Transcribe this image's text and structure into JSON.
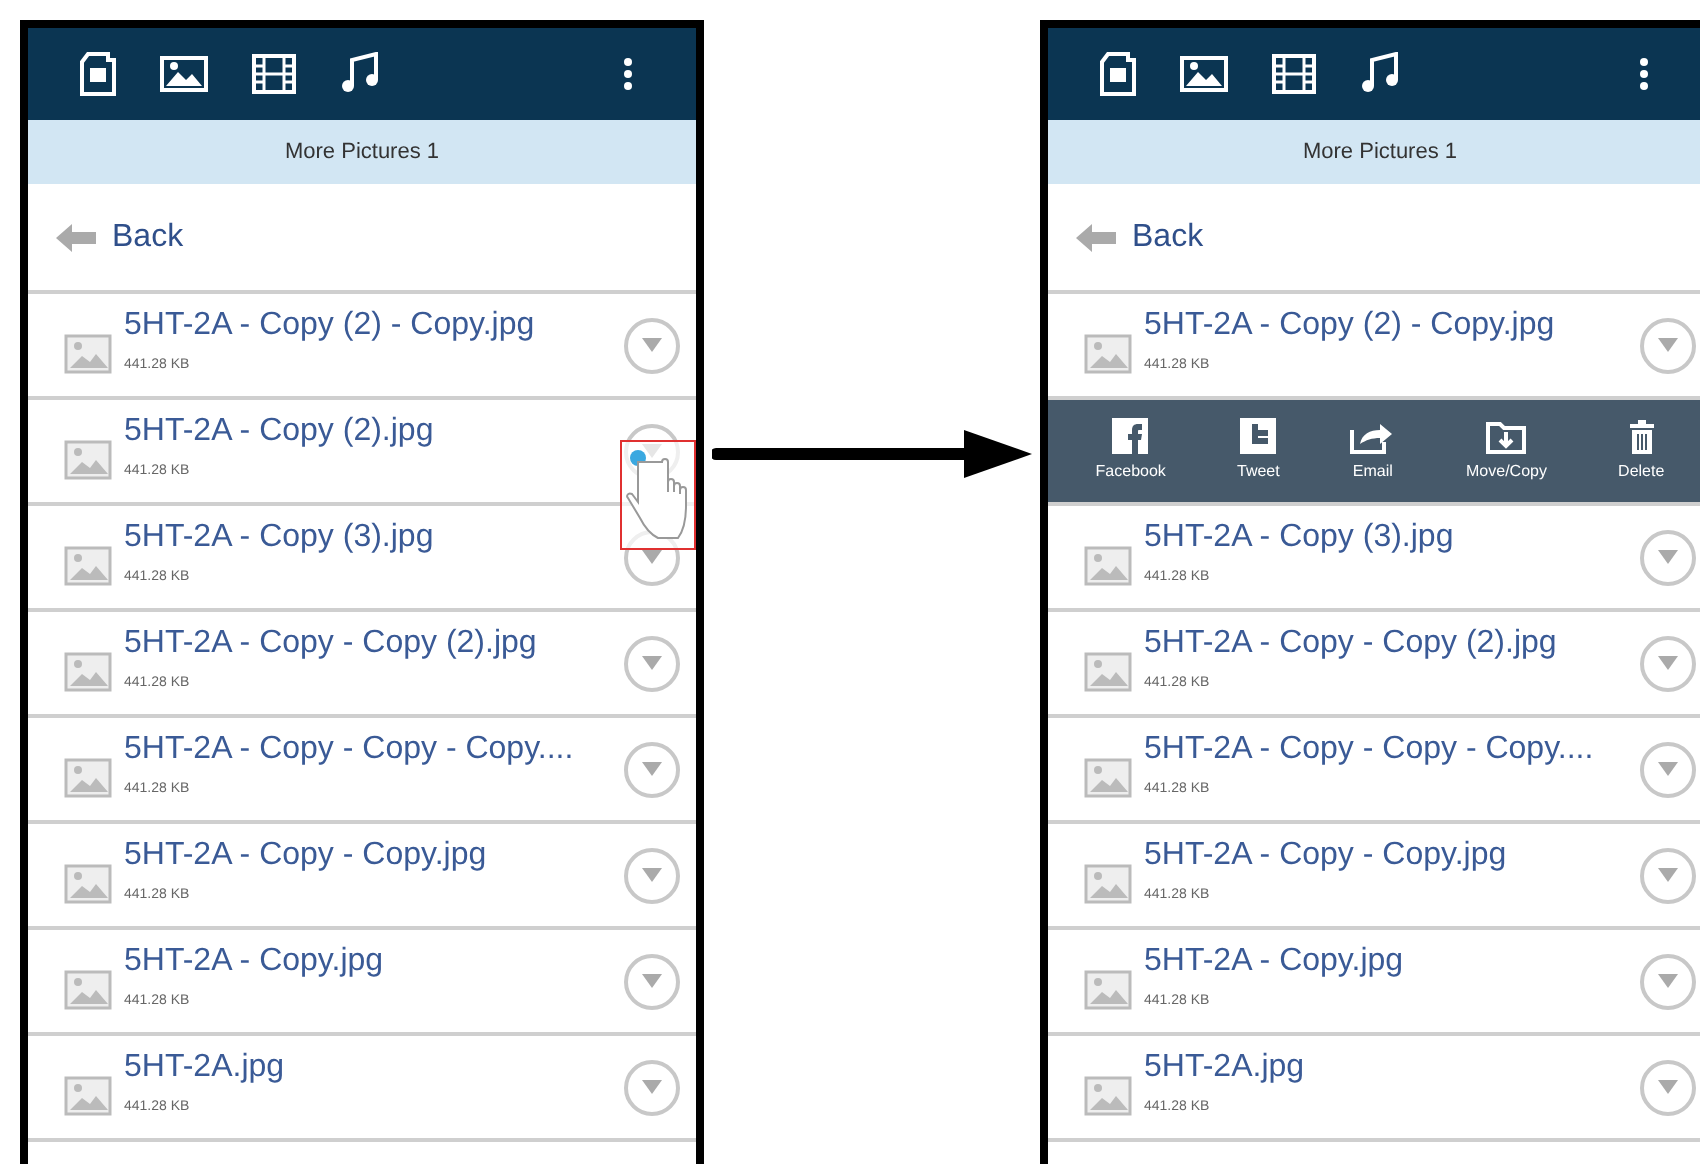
{
  "screens": [
    {
      "title": "More Pictures 1",
      "back": "Back",
      "rows": [
        {
          "kind": "file",
          "name": "5HT-2A - Copy (2) - Copy.jpg",
          "size": "441.28 KB",
          "touched": false
        },
        {
          "kind": "file",
          "name": "5HT-2A - Copy (2).jpg",
          "size": "441.28 KB",
          "touched": true
        },
        {
          "kind": "file",
          "name": "5HT-2A - Copy (3).jpg",
          "size": "441.28 KB",
          "touched": false
        },
        {
          "kind": "file",
          "name": "5HT-2A - Copy - Copy (2).jpg",
          "size": "441.28 KB",
          "touched": false
        },
        {
          "kind": "file",
          "name": "5HT-2A - Copy - Copy - Copy....",
          "size": "441.28 KB",
          "touched": false
        },
        {
          "kind": "file",
          "name": "5HT-2A - Copy - Copy.jpg",
          "size": "441.28 KB",
          "touched": false
        },
        {
          "kind": "file",
          "name": "5HT-2A - Copy.jpg",
          "size": "441.28 KB",
          "touched": false
        },
        {
          "kind": "file",
          "name": "5HT-2A.jpg",
          "size": "441.28 KB",
          "touched": false
        }
      ]
    },
    {
      "title": "More Pictures 1",
      "back": "Back",
      "rows": [
        {
          "kind": "file",
          "name": "5HT-2A - Copy (2) - Copy.jpg",
          "size": "441.28 KB",
          "touched": false
        },
        {
          "kind": "actions",
          "actions": [
            {
              "kind": "facebook",
              "label": "Facebook"
            },
            {
              "kind": "tweet",
              "label": "Tweet"
            },
            {
              "kind": "email",
              "label": "Email"
            },
            {
              "kind": "move",
              "label": "Move/Copy"
            },
            {
              "kind": "delete",
              "label": "Delete"
            }
          ]
        },
        {
          "kind": "file",
          "name": "5HT-2A - Copy (3).jpg",
          "size": "441.28 KB",
          "touched": false
        },
        {
          "kind": "file",
          "name": "5HT-2A - Copy - Copy (2).jpg",
          "size": "441.28 KB",
          "touched": false
        },
        {
          "kind": "file",
          "name": "5HT-2A - Copy - Copy - Copy....",
          "size": "441.28 KB",
          "touched": false
        },
        {
          "kind": "file",
          "name": "5HT-2A - Copy - Copy.jpg",
          "size": "441.28 KB",
          "touched": false
        },
        {
          "kind": "file",
          "name": "5HT-2A - Copy.jpg",
          "size": "441.28 KB",
          "touched": false
        },
        {
          "kind": "file",
          "name": "5HT-2A.jpg",
          "size": "441.28 KB",
          "touched": false
        }
      ]
    }
  ]
}
